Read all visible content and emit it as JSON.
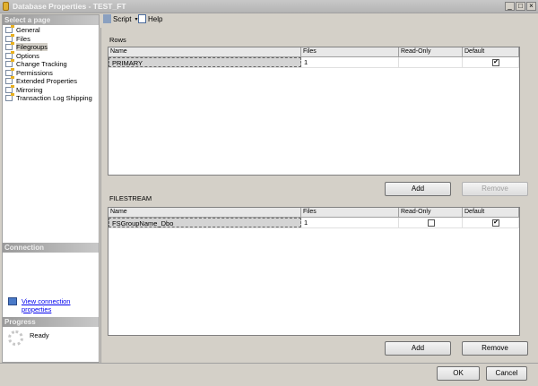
{
  "window": {
    "title": "Database Properties - TEST_FT",
    "minimize": "_",
    "maximize": "□",
    "close": "×"
  },
  "sidebar": {
    "header": "Select a page",
    "items": [
      {
        "label": "General"
      },
      {
        "label": "Files"
      },
      {
        "label": "Filegroups",
        "selected": true
      },
      {
        "label": "Options"
      },
      {
        "label": "Change Tracking"
      },
      {
        "label": "Permissions"
      },
      {
        "label": "Extended Properties"
      },
      {
        "label": "Mirroring"
      },
      {
        "label": "Transaction Log Shipping"
      }
    ]
  },
  "connection": {
    "header": "Connection",
    "link": "View connection properties"
  },
  "progress": {
    "header": "Progress",
    "status": "Ready"
  },
  "toolbar": {
    "script": "Script",
    "help": "Help"
  },
  "rows": {
    "label": "Rows",
    "columns": [
      "Name",
      "Files",
      "Read-Only",
      "Default"
    ],
    "data": [
      {
        "name": "PRIMARY",
        "files": "1",
        "read_only": null,
        "default": true
      }
    ],
    "add": "Add",
    "remove": "Remove"
  },
  "filestream": {
    "label": "FILESTREAM",
    "columns": [
      "Name",
      "Files",
      "Read-Only",
      "Default"
    ],
    "data": [
      {
        "name": "FSGroupName_Dbo",
        "files": "1",
        "read_only": false,
        "default": true
      }
    ],
    "add": "Add",
    "remove": "Remove"
  },
  "footer": {
    "ok": "OK",
    "cancel": "Cancel"
  },
  "check_mark": "✔"
}
